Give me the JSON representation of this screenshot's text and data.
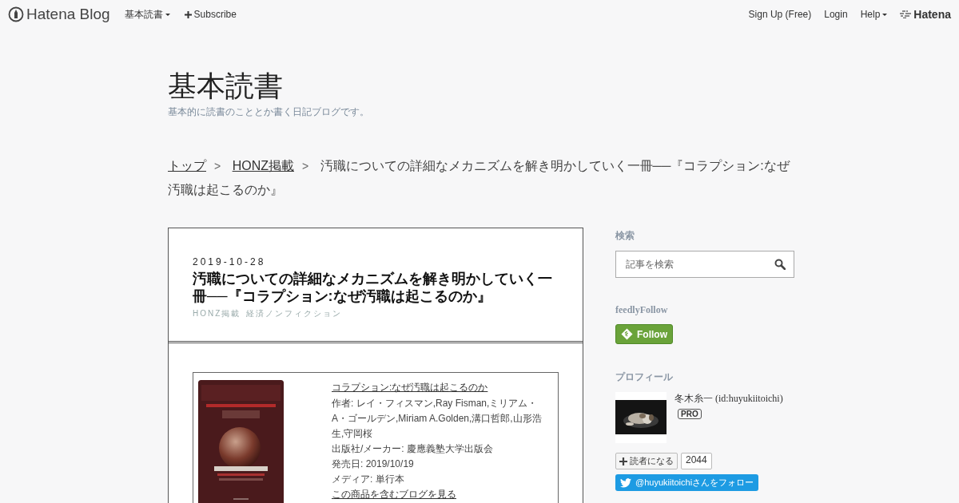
{
  "topbar": {
    "logo": "Hatena Blog",
    "blog_menu": "基本読書",
    "subscribe": "Subscribe",
    "right_links": [
      {
        "label": "Sign Up (Free)",
        "kind": "link"
      },
      {
        "label": "Login",
        "kind": "link"
      },
      {
        "label": "Help",
        "kind": "menu"
      }
    ],
    "brand": "Hatena"
  },
  "blog": {
    "title": "基本読書",
    "description": "基本的に読書のこととか書く日記ブログです。"
  },
  "breadcrumb": [
    {
      "label": "トップ",
      "kind": "link"
    },
    {
      "label": "HONZ掲載",
      "kind": "link"
    },
    {
      "label": "汚職についての詳細なメカニズムを解き明かしていく一冊──『コラプション:なぜ汚職は起こるのか』",
      "kind": "current"
    }
  ],
  "breadcrumb_separator": ">",
  "entry": {
    "date": "2019-10-28",
    "title": "汚職についての詳細なメカニズムを解き明かしていく一冊──『コラプション:なぜ汚職は起こるのか』",
    "categories": [
      "HONZ掲載",
      "経済ノンフィクション"
    ],
    "product": {
      "title": "コラプション:なぜ汚職は起こるのか",
      "details": [
        "作者: レイ・フィスマン,Ray Fisman,ミリアム・A・ゴールデン,Miriam A.Golden,溝口哲郎,山形浩生,守岡桜",
        "出版社/メーカー: 慶應義塾大学出版会",
        "発売日: 2019/10/19",
        "メディア: 単行本"
      ],
      "blog_link": "この商品を含むブログを見る"
    }
  },
  "sidebar": {
    "search": {
      "heading": "検索",
      "placeholder": "記事を検索"
    },
    "feedly": {
      "heading": "feedlyFollow",
      "button": "Follow"
    },
    "profile": {
      "heading": "プロフィール",
      "name": "冬木糸一",
      "id": "(id:huyukiitoichi)",
      "badge": "PRO",
      "subscribe": "読者になる",
      "count": "2044",
      "twitter": "@huyukiitoichiさんをフォロー"
    }
  }
}
